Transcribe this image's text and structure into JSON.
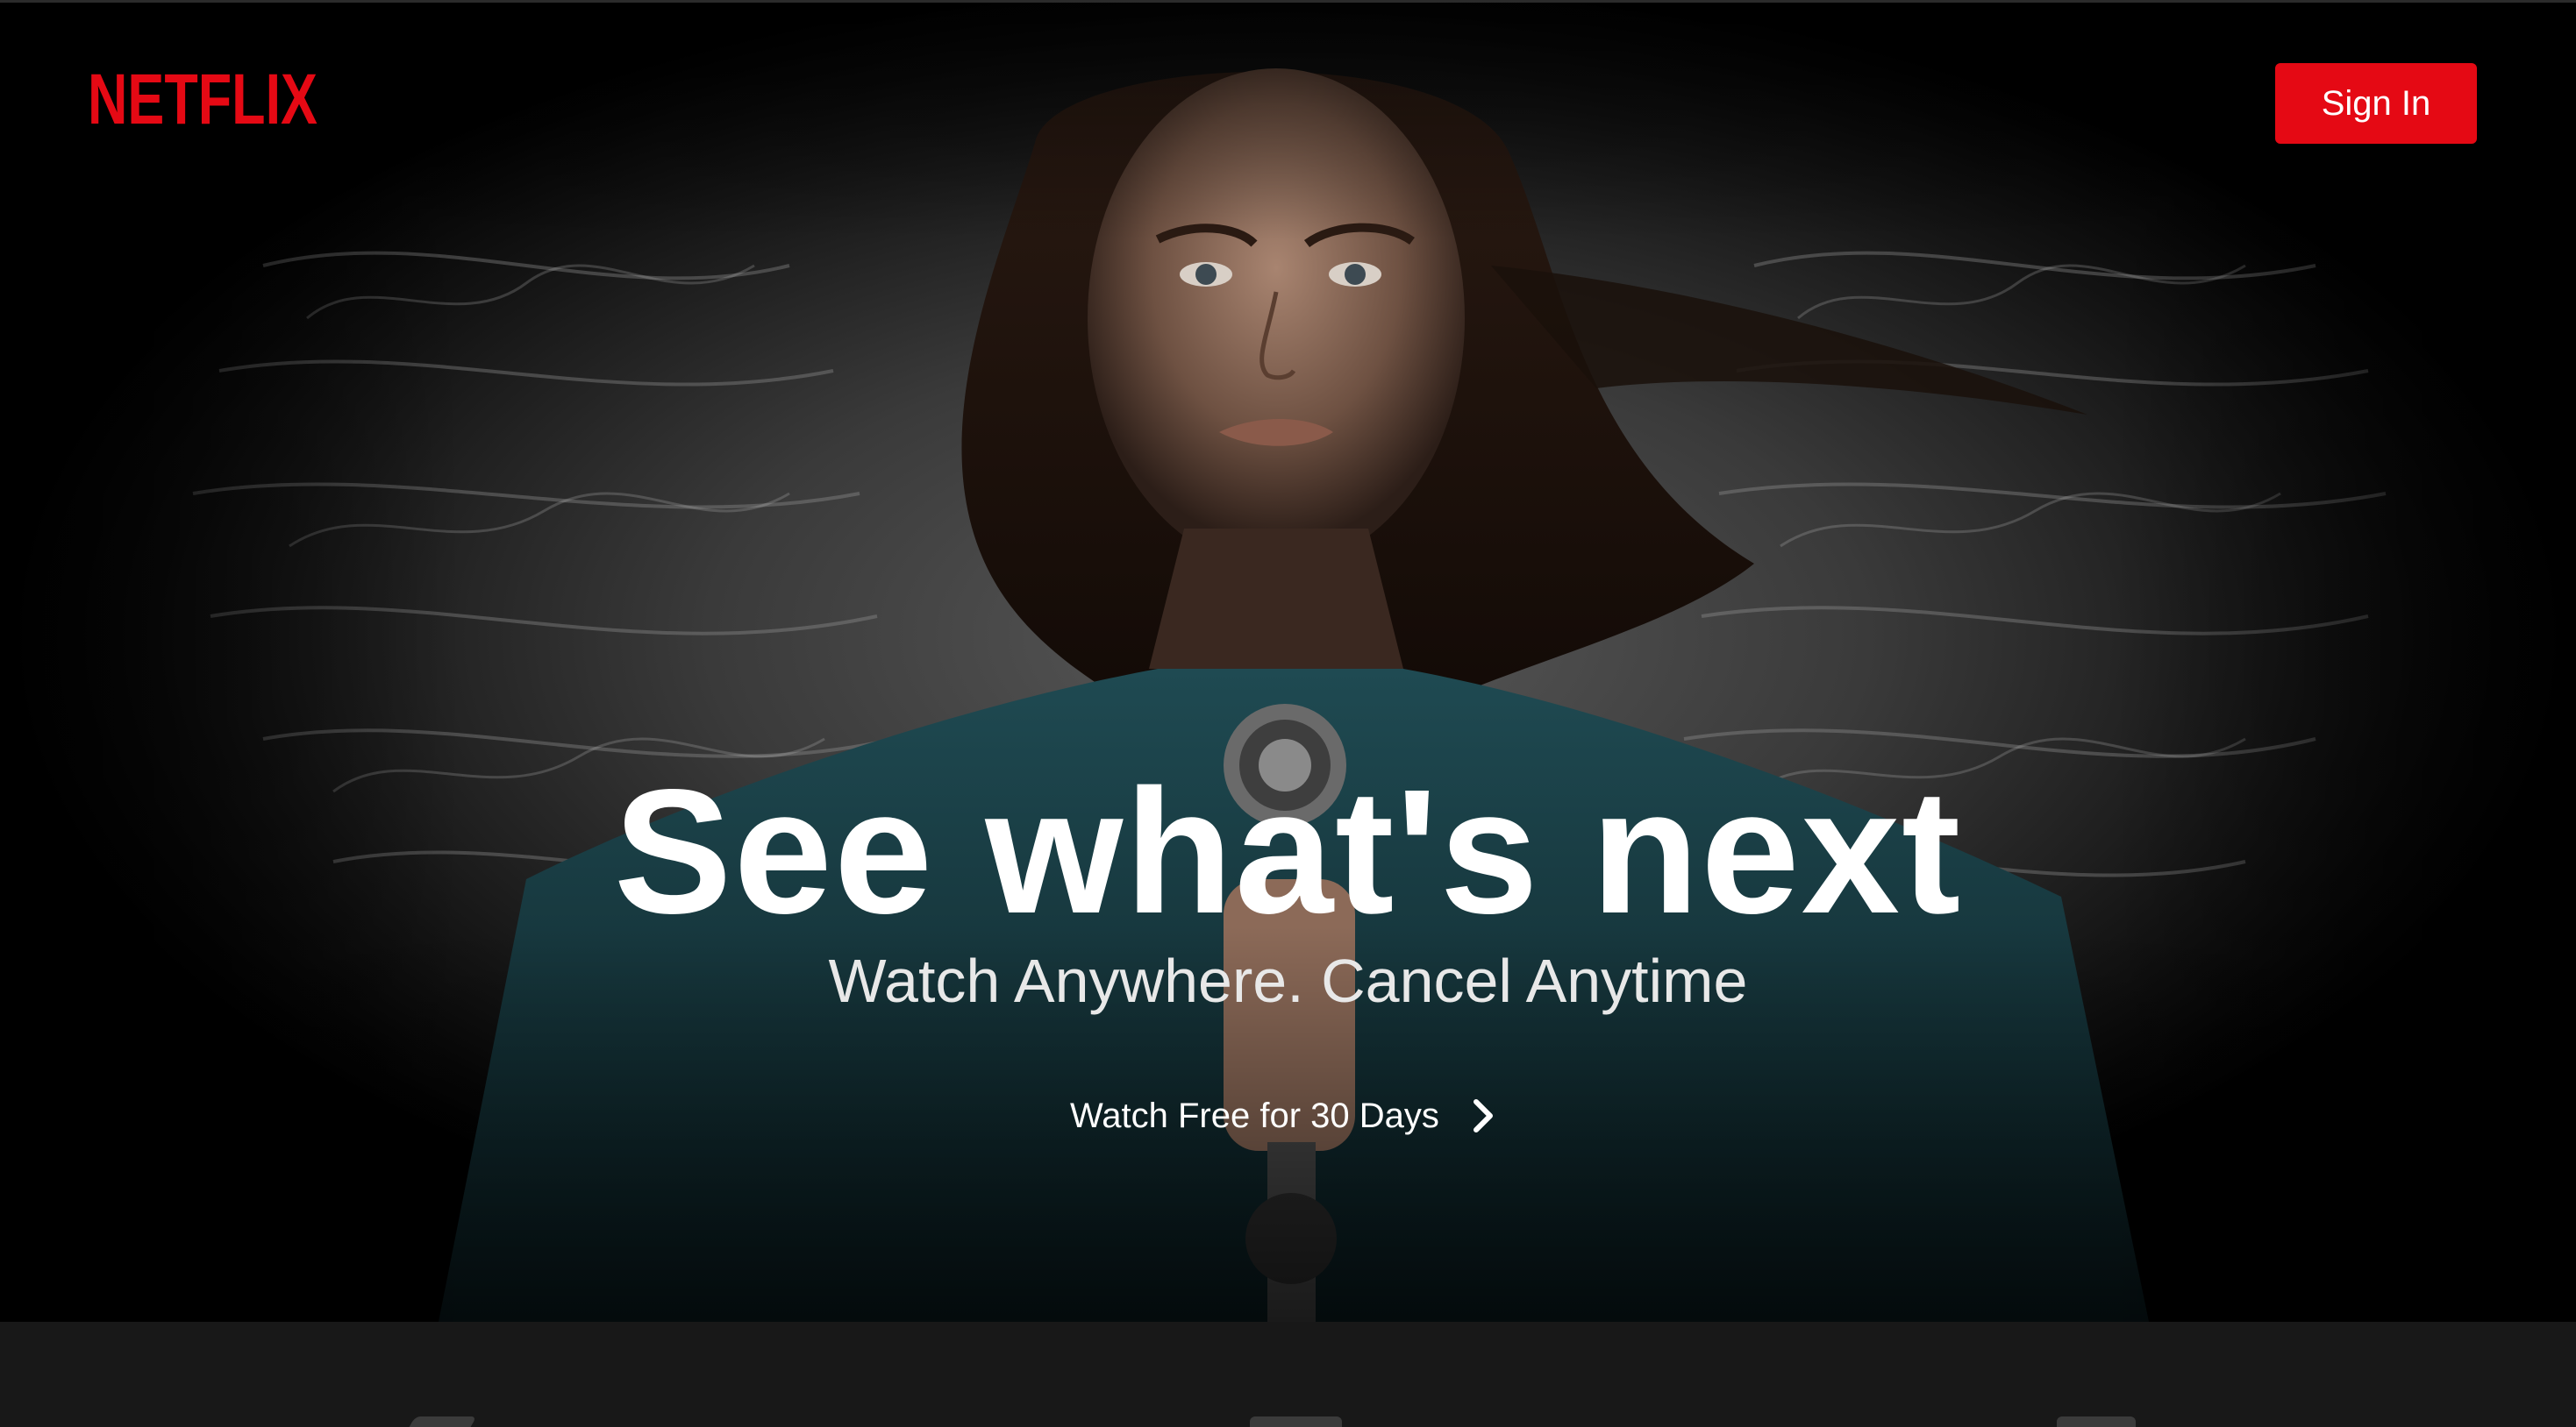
{
  "brand": {
    "logo_text": "NETFLIX",
    "logo_color": "#e50914"
  },
  "header": {
    "signin_label": "Sign In"
  },
  "hero": {
    "headline": "See what's next",
    "subheadline": "Watch Anywhere. Cancel Anytime",
    "cta_label": "Watch Free for 30 Days",
    "cta_icon": "chevron-right-icon"
  },
  "colors": {
    "accent": "#e50914",
    "background": "#000000",
    "bottom_band": "#181818"
  }
}
